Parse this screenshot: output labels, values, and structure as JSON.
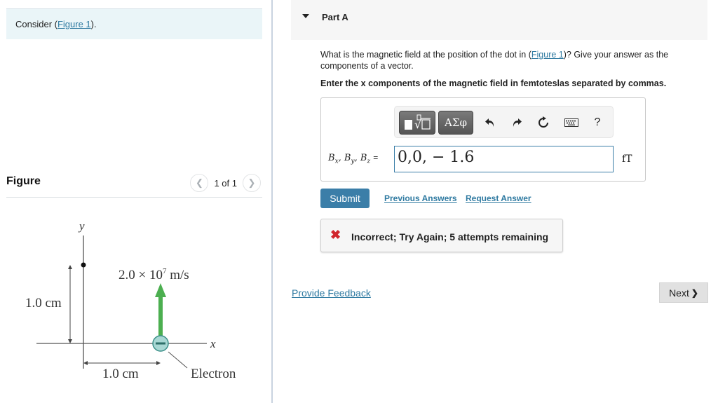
{
  "intro": {
    "prefix": "Consider (",
    "figure_link": "Figure 1",
    "suffix": ")."
  },
  "figure_panel": {
    "title": "Figure",
    "pager_text": "1 of 1",
    "prev_icon": "chevron-left-icon",
    "next_icon": "chevron-right-icon",
    "diagram": {
      "y_axis_label": "y",
      "x_axis_label": "x",
      "vertical_distance_label": "1.0 cm",
      "horizontal_distance_label": "1.0 cm",
      "velocity_label_base": "2.0 × 10",
      "velocity_label_exp": "7",
      "velocity_label_unit": " m/s",
      "particle_label": "Electron",
      "particle_sign": "−",
      "arrow_color": "#4caf50",
      "particle_fill": "#a8d8d4",
      "particle_stroke": "#3a8f88"
    }
  },
  "part": {
    "title": "Part A",
    "question_prefix": "What is the magnetic field at the position of the dot in (",
    "question_link": "Figure 1",
    "question_suffix": ")? Give your answer as the components of a vector.",
    "instruction": "Enter the x components of the magnetic field in femtoteslas separated by commas.",
    "toolbar": {
      "templates_icon": "■∜□",
      "symbols_label": "ΑΣφ",
      "undo_icon": "↶",
      "redo_icon": "↷",
      "reset_icon": "↻",
      "keyboard_icon": "⌨",
      "help_label": "?"
    },
    "var_label": {
      "b": "B",
      "sub_x": "x",
      "sub_y": "y",
      "sub_z": "z",
      "eq": "="
    },
    "answer_value": "0,0, − 1.6",
    "unit": "fT",
    "submit_label": "Submit",
    "previous_answers_label": "Previous Answers",
    "request_answer_label": "Request Answer",
    "feedback_icon": "✖",
    "feedback_text": "Incorrect; Try Again; 5 attempts remaining",
    "feedback_color": "#d0262d"
  },
  "footer": {
    "provide_feedback_label": "Provide Feedback",
    "next_label": "Next",
    "next_icon": "❯"
  }
}
